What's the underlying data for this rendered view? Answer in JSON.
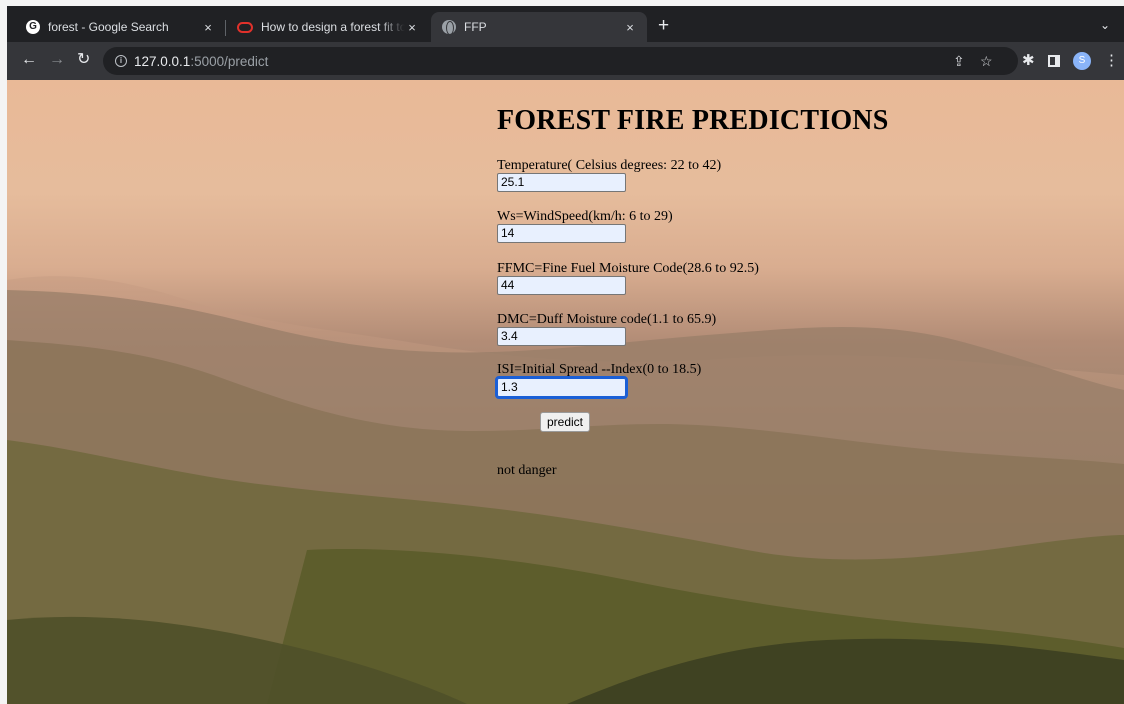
{
  "browser": {
    "tabs": [
      {
        "title": "forest - Google Search",
        "icon": "google-favicon",
        "active": false
      },
      {
        "title": "How to design a forest fit to ho",
        "icon": "oracle-favicon",
        "active": false
      },
      {
        "title": "FFP",
        "icon": "globe-favicon",
        "active": true
      }
    ],
    "new_tab_symbol": "+",
    "close_symbol": "×",
    "tab_menu_symbol": "⌄",
    "url_host": "127.0.0.1",
    "url_rest": ":5000/predict",
    "avatar_letter": "S"
  },
  "page": {
    "heading": "FOREST FIRE PREDICTIONS",
    "fields": [
      {
        "label": "Temperature( Celsius degrees: 22 to 42)",
        "value": "25.1"
      },
      {
        "label": "Ws=WindSpeed(km/h: 6 to 29)",
        "value": "14"
      },
      {
        "label": "FFMC=Fine Fuel Moisture Code(28.6 to 92.5)",
        "value": "44"
      },
      {
        "label": "DMC=Duff Moisture code(1.1 to 65.9)",
        "value": "3.4"
      },
      {
        "label": "ISI=Initial Spread --Index(0 to 18.5)",
        "value": "1.3"
      }
    ],
    "predict_label": "predict",
    "result": "not danger"
  },
  "colors": {
    "tabstrip": "#202124",
    "toolbar": "#35363a",
    "input_autofill": "#e8f0fe",
    "focus_ring": "#1a5fd6"
  }
}
